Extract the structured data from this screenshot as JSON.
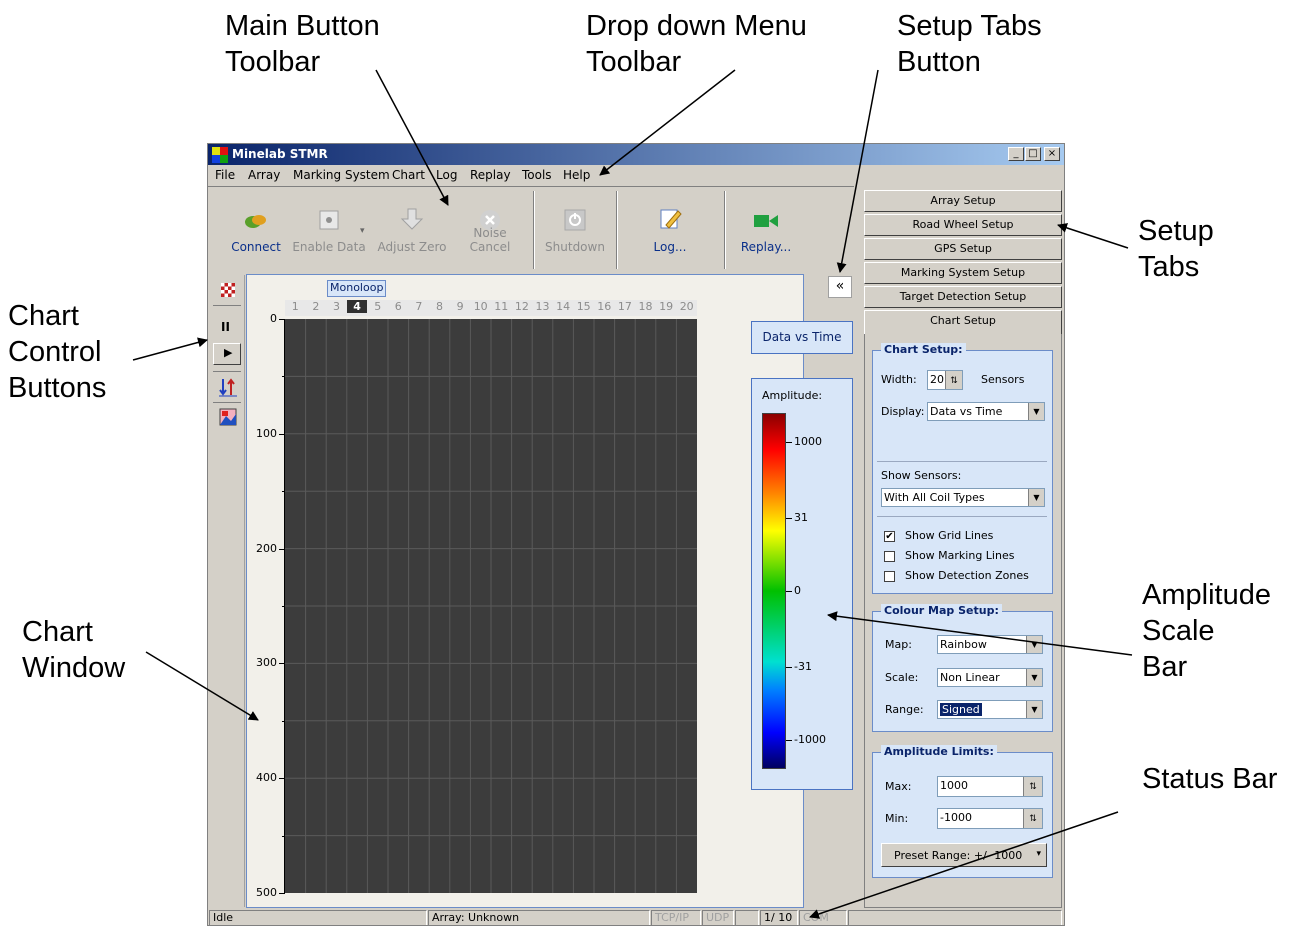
{
  "callouts": {
    "main_toolbar": "Main Button\nToolbar",
    "dropdown_toolbar": "Drop down Menu\nToolbar",
    "setup_tabs_button": "Setup Tabs\nButton",
    "chart_control": "Chart\nControl\nButtons",
    "setup_tabs": "Setup\nTabs",
    "amplitude_scale": "Amplitude\nScale\nBar",
    "chart_window": "Chart\nWindow",
    "status_bar": "Status Bar"
  },
  "window": {
    "title": "Minelab STMR",
    "minimize": "_",
    "maximize": "□",
    "close": "×"
  },
  "menu": [
    "File",
    "Array",
    "Marking System",
    "Chart",
    "Log",
    "Replay",
    "Tools",
    "Help"
  ],
  "toolbar": {
    "connect": "Connect",
    "enable_data": "Enable Data",
    "adjust_zero": "Adjust Zero",
    "noise_cancel": "Noise Cancel",
    "shutdown": "Shutdown",
    "log": "Log...",
    "replay": "Replay..."
  },
  "collapse_button": "«",
  "chart": {
    "group_label": "Monoloop",
    "sensors": [
      "1",
      "2",
      "3",
      "4",
      "5",
      "6",
      "7",
      "8",
      "9",
      "10",
      "11",
      "12",
      "13",
      "14",
      "15",
      "16",
      "17",
      "18",
      "19",
      "20"
    ],
    "selected_sensor": "4",
    "y_ticks": [
      "0",
      "100",
      "200",
      "300",
      "400",
      "500"
    ]
  },
  "display_mode_label": "Data vs Time",
  "scale_bar": {
    "title": "Amplitude:",
    "labels": [
      "1000",
      "31",
      "0",
      "-31",
      "-1000"
    ]
  },
  "tabs": [
    "Array Setup",
    "Road Wheel Setup",
    "GPS Setup",
    "Marking System Setup",
    "Target Detection Setup",
    "Chart Setup"
  ],
  "chart_setup": {
    "title": "Chart Setup:",
    "width_label": "Width:",
    "width_value": "20",
    "width_unit": "Sensors",
    "display_label": "Display:",
    "display_value": "Data vs Time",
    "show_sensors_label": "Show Sensors:",
    "show_sensors_value": "With All Coil Types",
    "show_grid": "Show Grid Lines",
    "show_marking": "Show Marking Lines",
    "show_detection": "Show Detection Zones"
  },
  "colour_map": {
    "title": "Colour Map Setup:",
    "map_label": "Map:",
    "map_value": "Rainbow",
    "scale_label": "Scale:",
    "scale_value": "Non Linear",
    "range_label": "Range:",
    "range_value": "Signed"
  },
  "amp_limits": {
    "title": "Amplitude Limits:",
    "max_label": "Max:",
    "max_value": "1000",
    "min_label": "Min:",
    "min_value": "-1000",
    "preset": "Preset Range: +/- 1000"
  },
  "status": {
    "state": "Idle",
    "array": "Array: Unknown",
    "tcp": "TCP/IP",
    "udp": "UDP",
    "page": "1/ 10",
    "com": "COM"
  },
  "colors": {
    "accent": "#0a246a",
    "panel_blue": "#d8e6f8",
    "chart_bg": "#3c3c3c"
  }
}
